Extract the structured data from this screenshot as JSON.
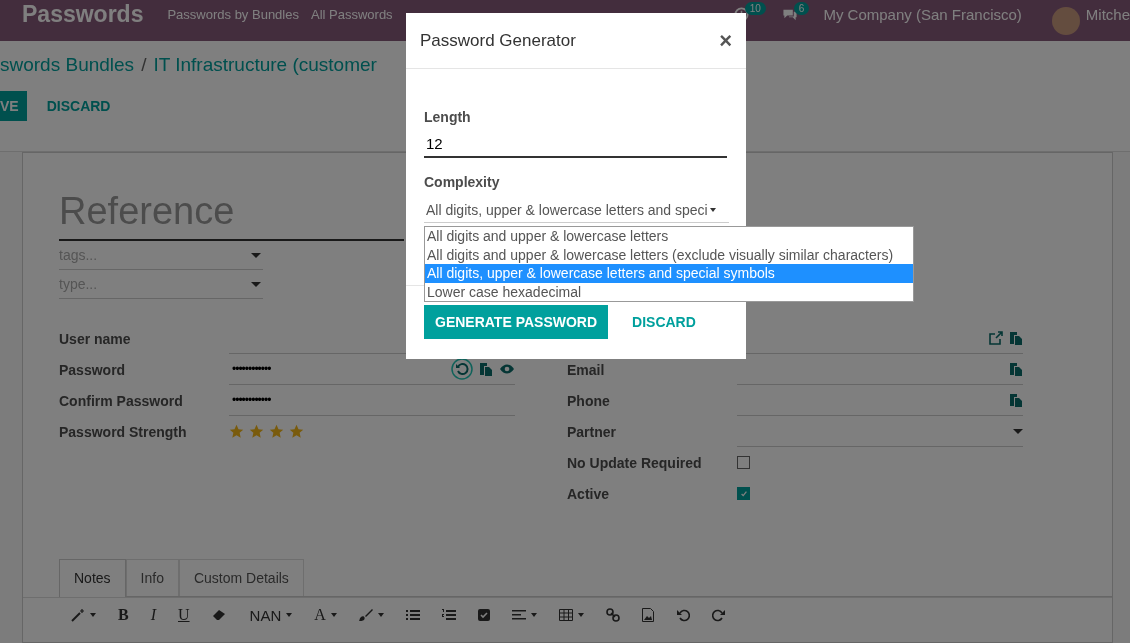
{
  "navbar": {
    "brand": "Passwords",
    "menu": [
      "Passwords by Bundles",
      "All Passwords"
    ],
    "activity_count": "10",
    "message_count": "6",
    "company": "My Company (San Francisco)",
    "user": "Mitche"
  },
  "breadcrumb": {
    "parent": "swords Bundles",
    "separator": "/",
    "current": "IT Infrastructure (customer"
  },
  "actions": {
    "save": "VE",
    "discard": "DISCARD"
  },
  "sheet": {
    "title_placeholder": "Reference",
    "tags_placeholder": "tags...",
    "type_placeholder": "type...",
    "left_fields": [
      {
        "label": "User name",
        "kind": "text"
      },
      {
        "label": "Password",
        "value": "••••••••••••",
        "kind": "password"
      },
      {
        "label": "Confirm Password",
        "value": "••••••••••••",
        "kind": "text"
      },
      {
        "label": "Password Strength",
        "kind": "stars",
        "stars": 4
      }
    ],
    "right_fields": [
      {
        "kind": "link"
      },
      {
        "label": "Email",
        "kind": "copy"
      },
      {
        "label": "Phone",
        "kind": "copy"
      },
      {
        "label": "Partner",
        "kind": "select"
      },
      {
        "label": "No Update Required",
        "kind": "checkbox",
        "checked": false
      },
      {
        "label": "Active",
        "kind": "checkbox",
        "checked": true
      }
    ],
    "tabs": [
      {
        "label": "Notes",
        "selected": true
      },
      {
        "label": "Info",
        "selected": false
      },
      {
        "label": "Custom Details",
        "selected": false
      }
    ],
    "editor_toolbar": {
      "bold": "B",
      "italic": "I",
      "underline": "U",
      "font_size": "NAN",
      "font_color": "A"
    }
  },
  "dialog": {
    "title": "Password Generator",
    "close": "×",
    "length_label": "Length",
    "length_value": "12",
    "complexity_label": "Complexity",
    "complexity_value": "All digits, upper & lowercase letters and speci",
    "options": [
      {
        "label": "All digits and upper & lowercase letters",
        "selected": false
      },
      {
        "label": "All digits and upper & lowercase letters (exclude visually similar characters)",
        "selected": false
      },
      {
        "label": "All digits, upper & lowercase letters and special symbols",
        "selected": true
      },
      {
        "label": "Lower case hexadecimal",
        "selected": false
      }
    ],
    "generate": "GENERATE PASSWORD",
    "discard": "DISCARD"
  }
}
